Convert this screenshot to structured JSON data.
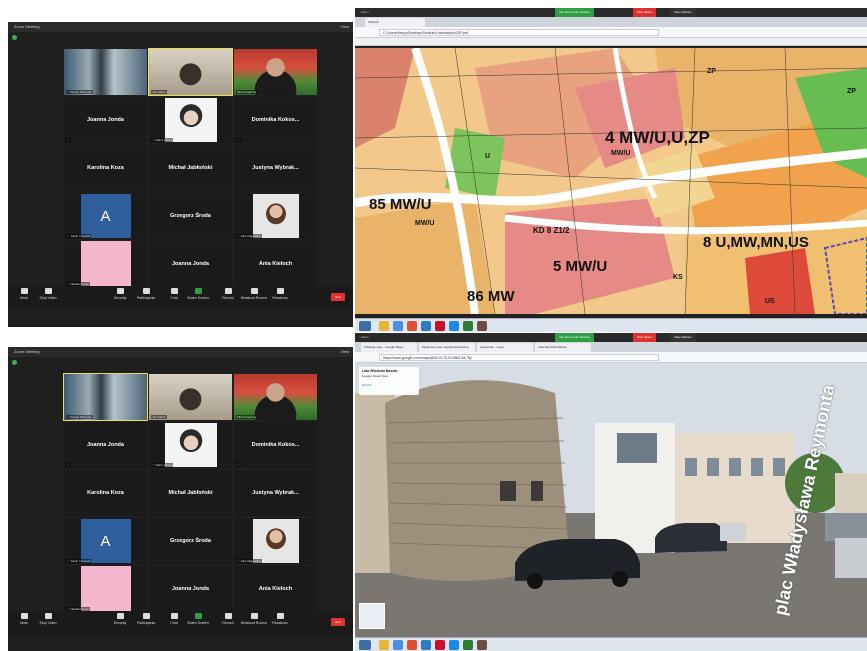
{
  "zoom_top": {
    "title": "Zoom Meeting",
    "view_label": "View",
    "participants": [
      {
        "name": "Patryk Wicentek",
        "type": "video1",
        "muted": true,
        "active": false
      },
      {
        "name": "Jan Kabat",
        "type": "video2",
        "muted": false,
        "active": true
      },
      {
        "name": "Michał Jędrzej",
        "type": "video3",
        "muted": false,
        "active": false
      },
      {
        "name": "Joanna Jonda",
        "type": "name",
        "muted": true
      },
      {
        "name": "Maria Wrona",
        "type": "drawing",
        "muted": true
      },
      {
        "name": "Dominika Kokos...",
        "type": "name",
        "muted": true
      },
      {
        "name": "Karolina Koza",
        "type": "name",
        "muted": false
      },
      {
        "name": "Michał Jabłoński",
        "type": "name",
        "muted": false
      },
      {
        "name": "Justyna Wybrak...",
        "type": "name",
        "muted": false
      },
      {
        "name": "Julian Trzeciak",
        "type": "letter",
        "letter": "A",
        "muted": true
      },
      {
        "name": "Grzegorz Środa",
        "type": "name",
        "muted": false
      },
      {
        "name": "Julia Majewska",
        "type": "photo",
        "muted": true
      },
      {
        "name": "Natalia Kopeć",
        "type": "pink",
        "muted": true
      },
      {
        "name": "Joanna Jonda",
        "type": "name",
        "muted": false
      },
      {
        "name": "Ania Kiełoch",
        "type": "name",
        "muted": false
      }
    ]
  },
  "zoom_bottom": {
    "title": "Zoom Meeting",
    "view_label": "View",
    "participants": [
      {
        "name": "Patryk Wicentek",
        "type": "video1",
        "muted": true,
        "active": true
      },
      {
        "name": "Jan Kabat",
        "type": "video2",
        "muted": false,
        "active": false
      },
      {
        "name": "Michał Jędrzej",
        "type": "video3",
        "muted": false,
        "active": false
      },
      {
        "name": "Joanna Jonda",
        "type": "name",
        "muted": true
      },
      {
        "name": "Maria Wrona",
        "type": "drawing",
        "muted": true
      },
      {
        "name": "Dominika Kokos...",
        "type": "name",
        "muted": true
      },
      {
        "name": "Karolina Koza",
        "type": "name",
        "muted": false
      },
      {
        "name": "Michał Jabłoński",
        "type": "name",
        "muted": false
      },
      {
        "name": "Justyna Wybrak...",
        "type": "name",
        "muted": false
      },
      {
        "name": "Julian Trzeciak",
        "type": "letter",
        "letter": "A",
        "muted": true
      },
      {
        "name": "Grzegorz Środa",
        "type": "name",
        "muted": false
      },
      {
        "name": "Julia Majewska",
        "type": "photo",
        "muted": true
      },
      {
        "name": "Natalia Kopeć",
        "type": "pink",
        "muted": true
      },
      {
        "name": "Joanna Jonda",
        "type": "name",
        "muted": false
      },
      {
        "name": "Ania Kiełoch",
        "type": "name",
        "muted": false
      }
    ]
  },
  "zoom_toolbar": {
    "buttons": [
      "Mute",
      "Stop Video",
      "Security",
      "Participants",
      "Chat",
      "Share Screen",
      "Record",
      "Breakout Rooms",
      "Reactions"
    ],
    "end_label": "End"
  },
  "map_browser": {
    "app_title": "Zoom",
    "banner": "You are screen sharing",
    "banner_stop": "Stop Share",
    "view_options": "View Options",
    "tab_label": "ZSP.pdf",
    "url": "C:/Users/Msuyk/Desktop/Studium/Urbanistyka/ZSP.pdf",
    "map_labels": [
      "4 MW/U,U,ZP",
      "85 MW/U",
      "KD 8 Z1/2",
      "5 MW/U",
      "86 MW",
      "8 U,MW,MN,US",
      "MW/U",
      "MW/U",
      "ZP",
      "ZP",
      "U",
      "US",
      "KS"
    ]
  },
  "sv_browser": {
    "app_title": "Zoom",
    "banner": "You are screen sharing",
    "banner_stop": "Stop Share",
    "view_options": "View Options",
    "tabs": [
      "Kolekcja map – Google Maps",
      "Miejscowy plan zagospodarowania",
      "Geoportal – mapa",
      "Lata Wieżowa Baszta"
    ],
    "url": "https://www.google.com/maps/@50.0175,20.9869,3a,75y",
    "place_title": "Lata Wieżowa Baszta",
    "place_sub": "Google Street View",
    "back_label": "Powrót",
    "street_name": "plac Władysława Reymonta"
  }
}
